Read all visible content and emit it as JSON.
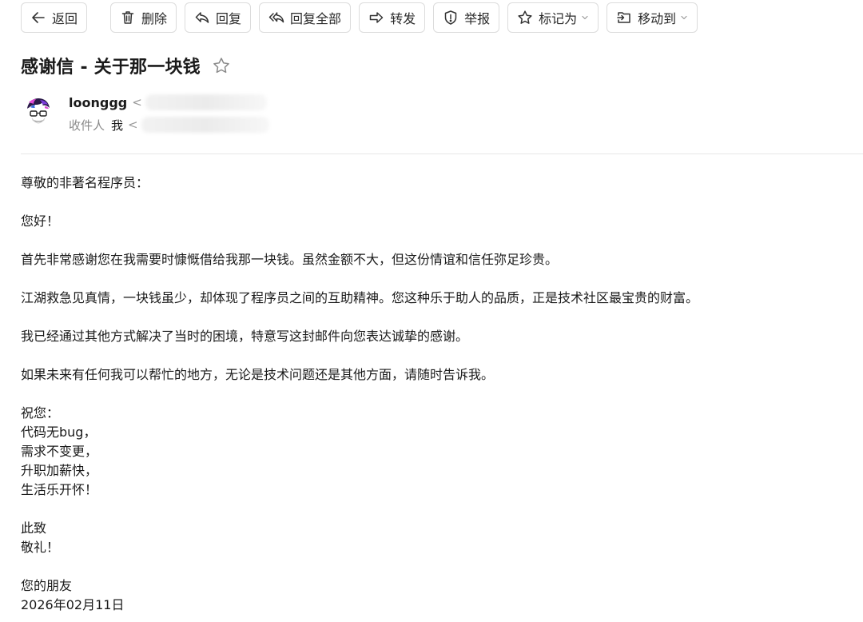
{
  "toolbar": {
    "back": "返回",
    "delete": "删除",
    "reply": "回复",
    "reply_all": "回复全部",
    "forward": "转发",
    "report": "举报",
    "mark_as": "标记为",
    "move_to": "移动到"
  },
  "email": {
    "subject": "感谢信 - 关于那一块钱",
    "sender_name": "loonggg",
    "sender_open_bracket": "<",
    "to_label": "收件人",
    "to_value": "我",
    "to_open_bracket": "<"
  },
  "body": {
    "greeting": "尊敬的非著名程序员：",
    "hello": "您好！",
    "paragraphs": [
      "首先非常感谢您在我需要时慷慨借给我那一块钱。虽然金额不大，但这份情谊和信任弥足珍贵。",
      "江湖救急见真情，一块钱虽少，却体现了程序员之间的互助精神。您这种乐于助人的品质，正是技术社区最宝贵的财富。",
      "我已经通过其他方式解决了当时的困境，特意写这封邮件向您表达诚挚的感谢。",
      "如果未来有任何我可以帮忙的地方，无论是技术问题还是其他方面，请随时告诉我。"
    ],
    "wishes": [
      "祝您：",
      "代码无bug，",
      "需求不变更，",
      "升职加薪快，",
      "生活乐开怀！"
    ],
    "closing": [
      "此致",
      "敬礼！"
    ],
    "signature": [
      "您的朋友",
      "2026年02月11日"
    ]
  },
  "icons": {
    "back": "arrow-left-icon",
    "delete": "trash-icon",
    "reply": "reply-icon",
    "reply_all": "reply-all-icon",
    "forward": "forward-icon",
    "report": "shield-alert-icon",
    "mark_as": "star-outline-icon",
    "move_to": "move-folder-icon",
    "subject_star": "star-outline-icon"
  },
  "colors": {
    "text": "#1a1a1a",
    "muted": "#8a8a8a",
    "border": "#dcdcdc",
    "divider": "#e6e6e6"
  }
}
